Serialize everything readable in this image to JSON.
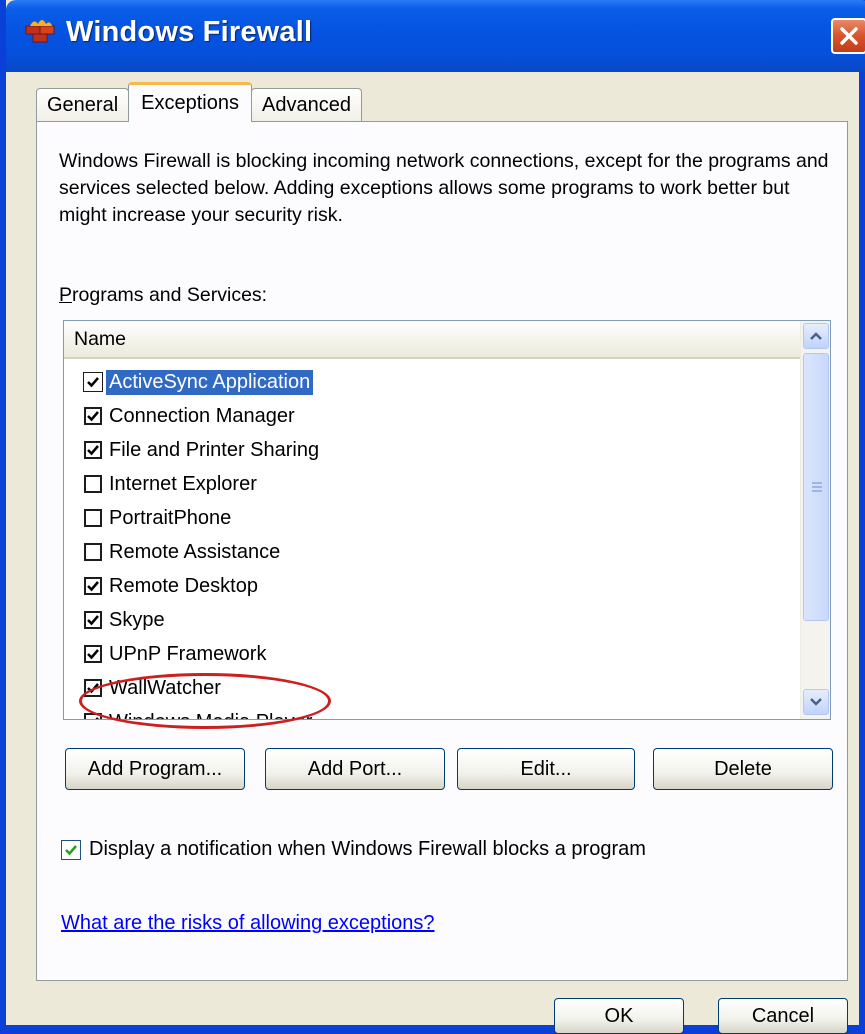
{
  "window": {
    "title": "Windows Firewall",
    "close_icon": "close-x-icon"
  },
  "tabs": [
    {
      "label": "General",
      "active": false
    },
    {
      "label": "Exceptions",
      "active": true
    },
    {
      "label": "Advanced",
      "active": false
    }
  ],
  "intro_text": "Windows Firewall is blocking incoming network connections, except for the programs and services selected below. Adding exceptions allows some programs to work better but might increase your security risk.",
  "programs_label": "Programs and Services:",
  "list": {
    "column_header": "Name",
    "items": [
      {
        "label": "ActiveSync Application",
        "checked": true,
        "selected": true
      },
      {
        "label": "Connection Manager",
        "checked": true
      },
      {
        "label": "File and Printer Sharing",
        "checked": true
      },
      {
        "label": "Internet Explorer",
        "checked": false
      },
      {
        "label": "PortraitPhone",
        "checked": false
      },
      {
        "label": "Remote Assistance",
        "checked": false
      },
      {
        "label": "Remote Desktop",
        "checked": true
      },
      {
        "label": "Skype",
        "checked": true
      },
      {
        "label": "UPnP Framework",
        "checked": true
      },
      {
        "label": "WallWatcher",
        "checked": true
      },
      {
        "label": "Windows Media Player",
        "checked": true
      }
    ]
  },
  "buttons": {
    "add_program": "Add Program...",
    "add_port": "Add Port...",
    "edit": "Edit...",
    "delete": "Delete",
    "ok": "OK",
    "cancel": "Cancel"
  },
  "notify": {
    "label": "Display a notification when Windows Firewall blocks a program",
    "checked": true
  },
  "risk_link": "What are the risks of allowing exceptions?",
  "colors": {
    "title_bar": "#0654e2",
    "selection": "#316ac5",
    "annotation": "#cc2020",
    "link": "#0000ff"
  }
}
